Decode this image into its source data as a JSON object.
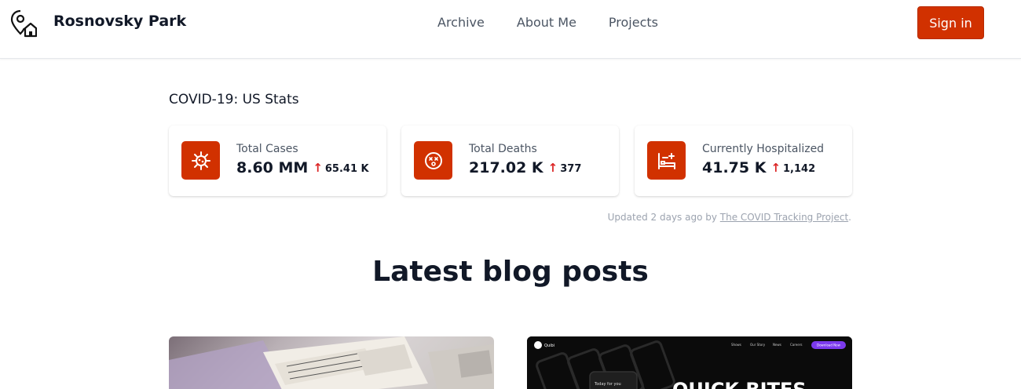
{
  "header": {
    "brand": "Rosnovsky Park",
    "nav": [
      "Archive",
      "About Me",
      "Projects"
    ],
    "sign_in": "Sign in"
  },
  "stats": {
    "title": "COVID-19: US Stats",
    "cards": [
      {
        "label": "Total Cases",
        "value": "8.60 MM",
        "delta": "65.41 K",
        "icon": "virus-icon"
      },
      {
        "label": "Total Deaths",
        "value": "217.02 K",
        "delta": "377",
        "icon": "dizzy-face-icon"
      },
      {
        "label": "Currently Hospitalized",
        "value": "41.75 K",
        "delta": "1,142",
        "icon": "hospital-bed-icon"
      }
    ],
    "updated_prefix": "Updated 2 days ago by ",
    "updated_link": "The COVID Tracking Project",
    "updated_suffix": "."
  },
  "blog": {
    "heading": "Latest blog posts",
    "thumb2": {
      "brand": "Quibi",
      "nav": [
        "Shows",
        "Our Story",
        "News",
        "Careers"
      ],
      "cta": "Download Now",
      "tag": "Today for you",
      "hero": "QUICK BITES"
    }
  },
  "colors": {
    "accent": "#d13100",
    "up_arrow": "#dc2626"
  }
}
